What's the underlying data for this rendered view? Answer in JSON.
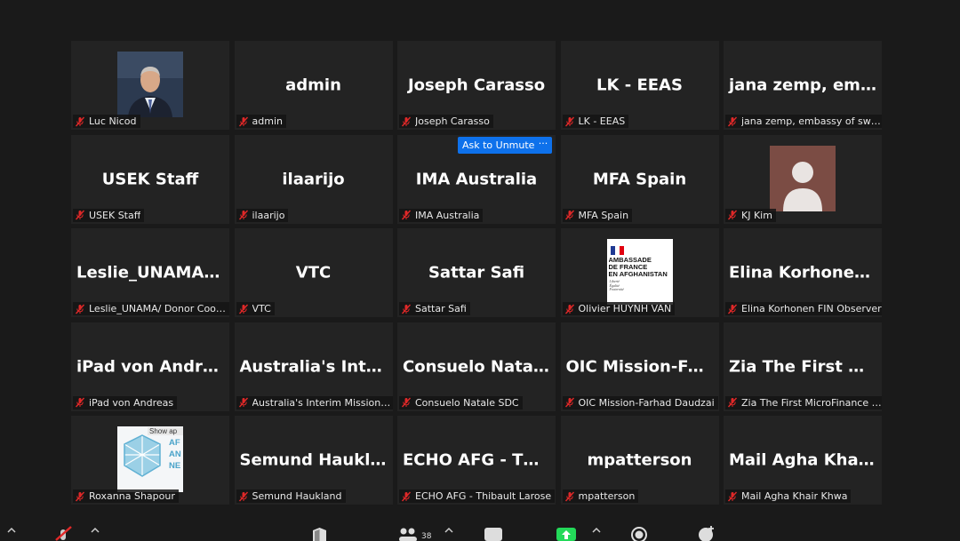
{
  "meeting": {
    "participant_count": "38",
    "tiles": [
      {
        "display": "photo-luc",
        "label": "Luc Nicod"
      },
      {
        "display": "name",
        "big_name": "admin",
        "label": "admin"
      },
      {
        "display": "name",
        "big_name": "Joseph Carasso",
        "label": "Joseph Carasso"
      },
      {
        "display": "name",
        "big_name": "LK - EEAS",
        "label": "LK - EEAS"
      },
      {
        "display": "name",
        "big_name": "jana zemp, embassy of switzerland",
        "label": "jana zemp, embassy of switzerland"
      },
      {
        "display": "name",
        "big_name": "USEK Staff",
        "label": "USEK Staff"
      },
      {
        "display": "name",
        "big_name": "ilaarijo",
        "label": "ilaarijo"
      },
      {
        "display": "name",
        "big_name": "IMA Australia",
        "label": "IMA Australia",
        "hover": true
      },
      {
        "display": "name",
        "big_name": "MFA Spain",
        "label": "MFA Spain"
      },
      {
        "display": "avatar",
        "label": "KJ Kim"
      },
      {
        "display": "name",
        "big_name": "Leslie_UNAMA/ Donor Coordination",
        "label": "Leslie_UNAMA/ Donor Coordination"
      },
      {
        "display": "name",
        "big_name": "VTC",
        "label": "VTC"
      },
      {
        "display": "name",
        "big_name": "Sattar Safi",
        "label": "Sattar Safi"
      },
      {
        "display": "embassy",
        "label": "Olivier HUYNH VAN"
      },
      {
        "display": "name",
        "big_name": "Elina Korhonen FIN Observer",
        "label": "Elina Korhonen FIN Observer"
      },
      {
        "display": "name",
        "big_name": "iPad von Andreas",
        "label": "iPad von Andreas"
      },
      {
        "display": "name",
        "big_name": "Australia's Interim Mission of Afghanistan",
        "label": "Australia's Interim Mission of Afghanistan"
      },
      {
        "display": "name",
        "big_name": "Consuelo Natale SDC",
        "label": "Consuelo Natale SDC"
      },
      {
        "display": "name",
        "big_name": "OIC Mission-Farhad Daudzai",
        "label": "OIC Mission-Farhad Daudzai"
      },
      {
        "display": "name",
        "big_name": "Zia The First MicroFinance Bank",
        "label": "Zia The First MicroFinance Bank"
      },
      {
        "display": "logo",
        "label": "Roxanna Shapour"
      },
      {
        "display": "name",
        "big_name": "Semund Haukland",
        "label": "Semund Haukland"
      },
      {
        "display": "name",
        "big_name": "ECHO AFG - Thibault Larose",
        "label": "ECHO AFG - Thibault Larose"
      },
      {
        "display": "name",
        "big_name": "mpatterson",
        "label": "mpatterson"
      },
      {
        "display": "name",
        "big_name": "Mail Agha Khair Khwa",
        "label": "Mail Agha Khair Khwa"
      }
    ]
  },
  "hover_controls": {
    "ask_to_unmute_label": "Ask to Unmute",
    "more_label": "···"
  },
  "embassy_logo": {
    "text": "AMBASSADE\nDE FRANCE\nEN AFGHANISTAN",
    "motto": "Liberté\nÉgalité\nFraternité"
  },
  "roxanna_logo": {
    "corner_text": "Show ap",
    "side_text": "AF\nAN\nNE"
  },
  "colors": {
    "background": "#1a1a1a",
    "tile": "#232323",
    "mute_red": "#e02828",
    "accent_blue": "#0e71eb",
    "share_green": "#23d959"
  },
  "icons": [
    "microphone-muted-icon",
    "security-shield-icon",
    "participants-icon",
    "chat-icon",
    "share-screen-icon",
    "record-icon",
    "reactions-icon"
  ]
}
